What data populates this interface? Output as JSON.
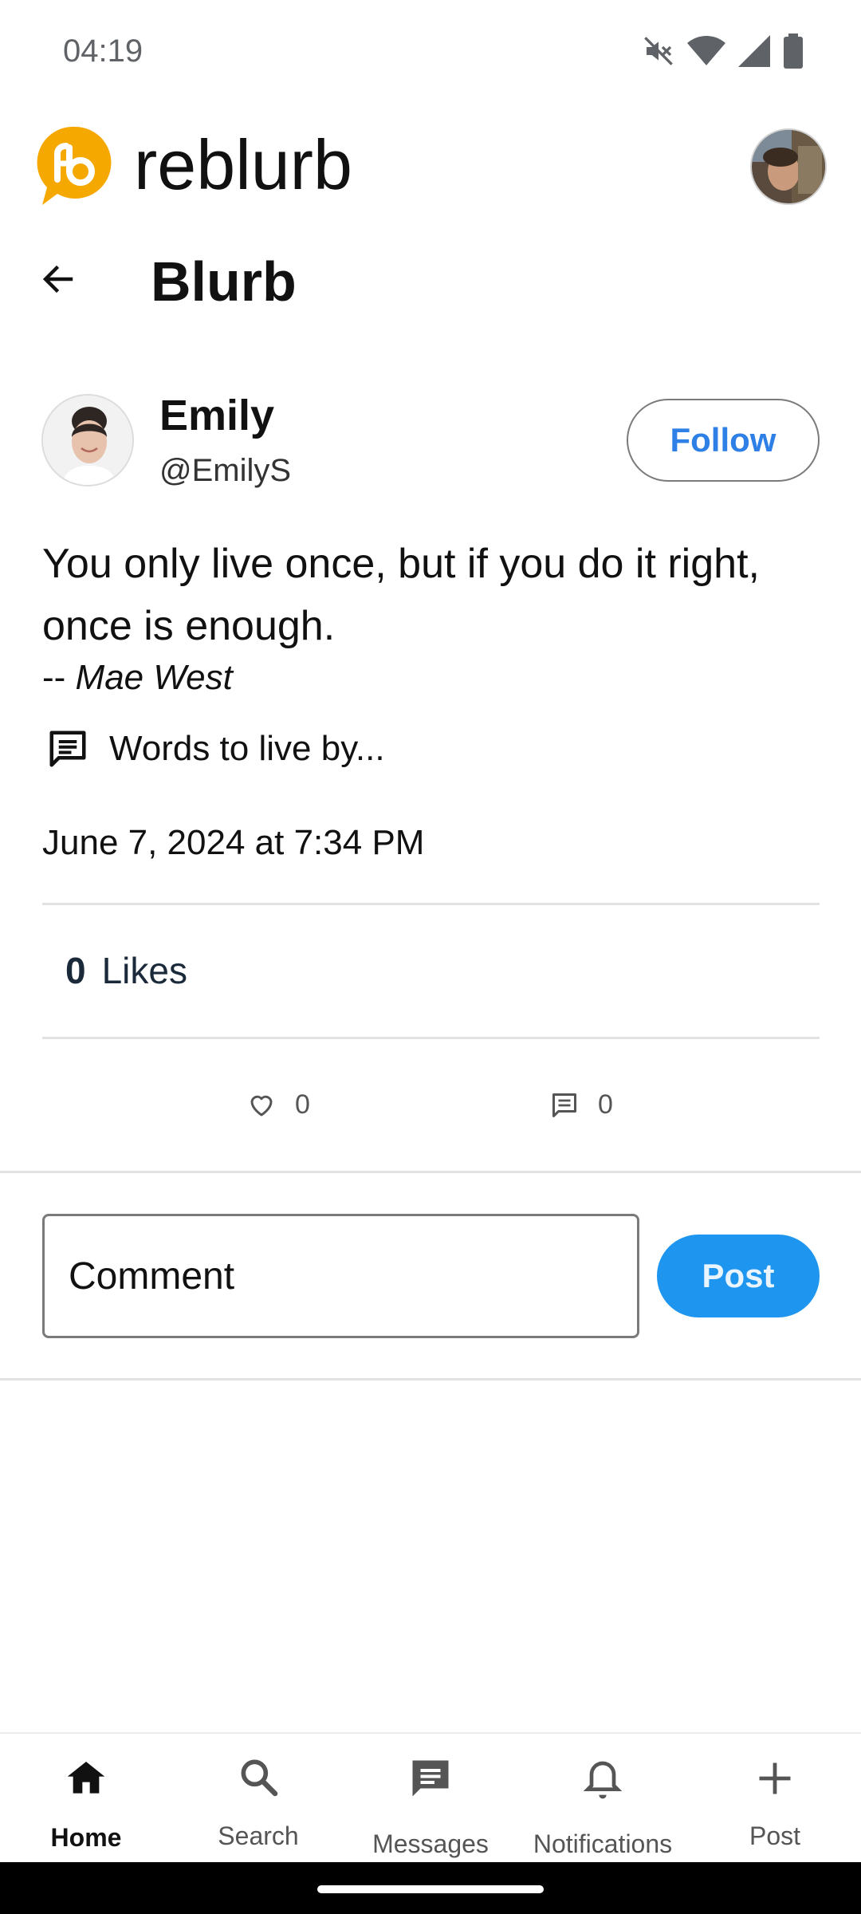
{
  "status_bar": {
    "time": "04:19",
    "icons": [
      "mute-icon",
      "wifi-icon",
      "signal-icon",
      "battery-icon"
    ]
  },
  "app": {
    "title": "reblurb",
    "logo_color": "#F5A800"
  },
  "page": {
    "title": "Blurb"
  },
  "author": {
    "name": "Emily",
    "handle": "@EmilyS",
    "follow_label": "Follow"
  },
  "post": {
    "quote": "You only live once, but if you do it right, once is enough.",
    "quote_prefix": "--",
    "quote_author": "Mae West",
    "caption": "Words to live by...",
    "date": "June 7, 2024 at 7:34 PM",
    "likes_count": "0",
    "likes_label": "Likes",
    "heart_count": "0",
    "comment_count": "0"
  },
  "comment_box": {
    "placeholder": "Comment",
    "post_label": "Post"
  },
  "bottom_nav": {
    "items": [
      {
        "label": "Home",
        "icon": "home-icon",
        "active": true
      },
      {
        "label": "Search",
        "icon": "search-icon",
        "active": false
      },
      {
        "label": "Messages",
        "icon": "messages-icon",
        "active": false
      },
      {
        "label": "Notifications",
        "icon": "bell-icon",
        "active": false
      },
      {
        "label": "Post",
        "icon": "plus-icon",
        "active": false
      }
    ]
  },
  "colors": {
    "accent_blue": "#2F80E6",
    "post_button": "#1E96F0"
  }
}
